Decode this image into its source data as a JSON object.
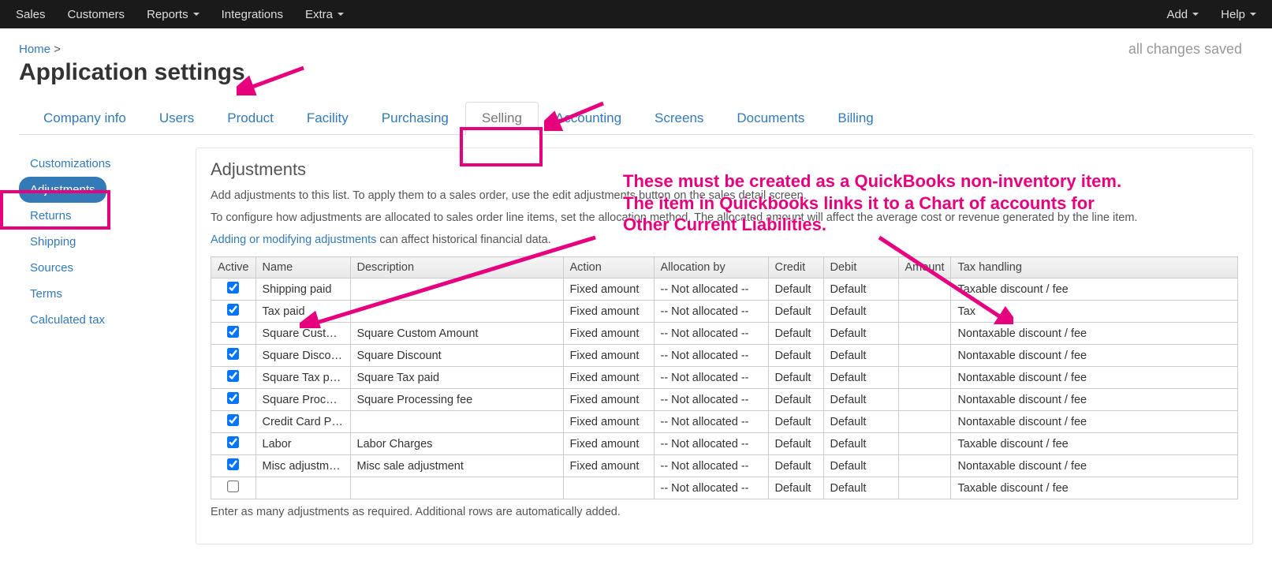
{
  "navbar": {
    "left": [
      "Sales",
      "Customers",
      "Reports",
      "Integrations",
      "Extra"
    ],
    "left_caret": [
      false,
      false,
      true,
      false,
      true
    ],
    "right": [
      "Add",
      "Help"
    ],
    "right_caret": [
      true,
      true
    ]
  },
  "breadcrumb": {
    "home": "Home",
    "sep": ">"
  },
  "title": "Application settings",
  "save_status": "all changes saved",
  "tabs": [
    {
      "label": "Company info",
      "active": false
    },
    {
      "label": "Users",
      "active": false
    },
    {
      "label": "Product",
      "active": false
    },
    {
      "label": "Facility",
      "active": false
    },
    {
      "label": "Purchasing",
      "active": false
    },
    {
      "label": "Selling",
      "active": true
    },
    {
      "label": "Accounting",
      "active": false
    },
    {
      "label": "Screens",
      "active": false
    },
    {
      "label": "Documents",
      "active": false
    },
    {
      "label": "Billing",
      "active": false
    }
  ],
  "sidebar": [
    {
      "label": "Customizations",
      "active": false
    },
    {
      "label": "Adjustments",
      "active": true
    },
    {
      "label": "Returns",
      "active": false
    },
    {
      "label": "Shipping",
      "active": false
    },
    {
      "label": "Sources",
      "active": false
    },
    {
      "label": "Terms",
      "active": false
    },
    {
      "label": "Calculated tax",
      "active": false
    }
  ],
  "panel": {
    "heading": "Adjustments",
    "p1": "Add adjustments to this list. To apply them to a sales order, use the edit adjustments button on the sales detail screen.",
    "p2": "To configure how adjustments are allocated to sales order line items, set the allocation method. The allocated amount will affect the average cost or revenue generated by the line item.",
    "p3_link": "Adding or modifying adjustments",
    "p3_rest": " can affect historical financial data.",
    "footnote": "Enter as many adjustments as required. Additional rows are automatically added."
  },
  "table": {
    "headers": [
      "Active",
      "Name",
      "Description",
      "Action",
      "Allocation by",
      "Credit",
      "Debit",
      "Amount",
      "Tax handling"
    ],
    "rows": [
      {
        "active": true,
        "name": "Shipping paid",
        "desc": "",
        "action": "Fixed amount",
        "alloc": "-- Not allocated --",
        "credit": "Default",
        "debit": "Default",
        "amount": "",
        "tax": "Taxable discount / fee"
      },
      {
        "active": true,
        "name": "Tax paid",
        "desc": "",
        "action": "Fixed amount",
        "alloc": "-- Not allocated --",
        "credit": "Default",
        "debit": "Default",
        "amount": "",
        "tax": "Tax"
      },
      {
        "active": true,
        "name": "Square Custo…",
        "desc": "Square Custom Amount",
        "action": "Fixed amount",
        "alloc": "-- Not allocated --",
        "credit": "Default",
        "debit": "Default",
        "amount": "",
        "tax": "Nontaxable discount / fee"
      },
      {
        "active": true,
        "name": "Square Disco…",
        "desc": "Square Discount",
        "action": "Fixed amount",
        "alloc": "-- Not allocated --",
        "credit": "Default",
        "debit": "Default",
        "amount": "",
        "tax": "Nontaxable discount / fee"
      },
      {
        "active": true,
        "name": "Square Tax paid",
        "desc": "Square Tax paid",
        "action": "Fixed amount",
        "alloc": "-- Not allocated --",
        "credit": "Default",
        "debit": "Default",
        "amount": "",
        "tax": "Nontaxable discount / fee"
      },
      {
        "active": true,
        "name": "Square Proce…",
        "desc": "Square Processing fee",
        "action": "Fixed amount",
        "alloc": "-- Not allocated --",
        "credit": "Default",
        "debit": "Default",
        "amount": "",
        "tax": "Nontaxable discount / fee"
      },
      {
        "active": true,
        "name": "Credit Card P…",
        "desc": "",
        "action": "Fixed amount",
        "alloc": "-- Not allocated --",
        "credit": "Default",
        "debit": "Default",
        "amount": "",
        "tax": "Nontaxable discount / fee"
      },
      {
        "active": true,
        "name": "Labor",
        "desc": "Labor Charges",
        "action": "Fixed amount",
        "alloc": "-- Not allocated --",
        "credit": "Default",
        "debit": "Default",
        "amount": "",
        "tax": "Taxable discount / fee"
      },
      {
        "active": true,
        "name": "Misc adjustment",
        "desc": "Misc sale adjustment",
        "action": "Fixed amount",
        "alloc": "-- Not allocated --",
        "credit": "Default",
        "debit": "Default",
        "amount": "",
        "tax": "Nontaxable discount / fee"
      },
      {
        "active": false,
        "name": "",
        "desc": "",
        "action": "",
        "alloc": "-- Not allocated --",
        "credit": "Default",
        "debit": "Default",
        "amount": "",
        "tax": "Taxable discount / fee"
      }
    ]
  },
  "annotation_text": "These must be created as a QuickBooks non-inventory item. The item in Quickbooks links it to a Chart of accounts for Other Current Liabilities."
}
